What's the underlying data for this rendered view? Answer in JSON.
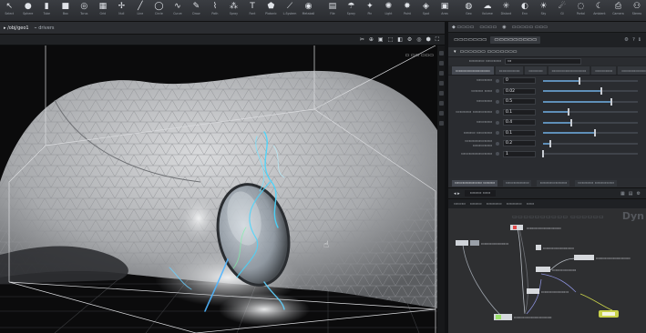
{
  "shelf": {
    "tools": [
      {
        "icon": "cursor-icon",
        "glyph": "↖",
        "label": "Select"
      },
      {
        "icon": "sphere-icon",
        "glyph": "●",
        "label": "Sphere"
      },
      {
        "icon": "tube-icon",
        "glyph": "▮",
        "label": "Tube"
      },
      {
        "icon": "box-icon",
        "glyph": "■",
        "label": "Box"
      },
      {
        "icon": "torus-icon",
        "glyph": "◎",
        "label": "Torus"
      },
      {
        "icon": "grid-icon",
        "glyph": "▦",
        "label": "Grid"
      },
      {
        "icon": "null-icon",
        "glyph": "✢",
        "label": "Null"
      },
      {
        "icon": "line-icon",
        "glyph": "╱",
        "label": "Line"
      },
      {
        "icon": "circle-icon",
        "glyph": "◯",
        "label": "Circle"
      },
      {
        "icon": "curve-icon",
        "glyph": "∿",
        "label": "Curve"
      },
      {
        "icon": "draw-icon",
        "glyph": "✎",
        "label": "Draw"
      },
      {
        "icon": "path-icon",
        "glyph": "⌇",
        "label": "Path"
      },
      {
        "icon": "spray-icon",
        "glyph": "⁂",
        "label": "Spray"
      },
      {
        "icon": "font-icon",
        "glyph": "T",
        "label": "Font"
      },
      {
        "icon": "platonic-icon",
        "glyph": "⬟",
        "label": "Platonic"
      },
      {
        "icon": "lsystem-icon",
        "glyph": "⟋",
        "label": "L-System"
      },
      {
        "icon": "metaball-icon",
        "glyph": "◉",
        "label": "Metaball"
      },
      {
        "icon": "file-icon",
        "glyph": "▤",
        "label": "File"
      },
      {
        "icon": "spray-paint-icon",
        "glyph": "☂",
        "label": "Spray"
      },
      {
        "icon": "pin-icon",
        "glyph": "✦",
        "label": "Pin"
      },
      {
        "icon": "light-icon",
        "glyph": "✺",
        "label": "Light"
      },
      {
        "icon": "point-icon",
        "glyph": "✸",
        "label": "Point"
      },
      {
        "icon": "spot-icon",
        "glyph": "◈",
        "label": "Spot"
      },
      {
        "icon": "area-icon",
        "glyph": "▣",
        "label": "Area"
      },
      {
        "icon": "geo-icon",
        "glyph": "◍",
        "label": "Geo"
      },
      {
        "icon": "volume-icon",
        "glyph": "☁",
        "label": "Volume"
      },
      {
        "icon": "distant-icon",
        "glyph": "✳",
        "label": "Distant"
      },
      {
        "icon": "env-icon",
        "glyph": "◐",
        "label": "Env"
      },
      {
        "icon": "sky-icon",
        "glyph": "☀",
        "label": "Sky"
      },
      {
        "icon": "gi-icon",
        "glyph": "☄",
        "label": "GI"
      },
      {
        "icon": "portal-icon",
        "glyph": "◌",
        "label": "Portal"
      },
      {
        "icon": "ambient-icon",
        "glyph": "☾",
        "label": "Ambient"
      },
      {
        "icon": "camera-icon",
        "glyph": "⎙",
        "label": "Camera"
      },
      {
        "icon": "stereo-icon",
        "glyph": "⚇",
        "label": "Stereo"
      }
    ]
  },
  "viewport": {
    "tabs": [
      "▸ /obj/geo1",
      "⌁ drivers"
    ],
    "toolbar_icons": [
      "✂",
      "⊕",
      "▣",
      "⬚",
      "◧",
      "⚙",
      "◎",
      "⬢",
      "⛶"
    ],
    "view_label": "▭ ▭▭   ▭▭▭"
  },
  "right": {
    "topbar": [
      "◆ ▭▭▭▭",
      "▭▭▭▭",
      "◉",
      "▭▭▭▭▭ ▭▭▭"
    ],
    "param_head": {
      "type": "▭▭▭▭▭▭▭",
      "node": "▭▭▭▭▭▭▭▭▭",
      "icons": [
        "⚙",
        "?",
        "ℹ"
      ]
    },
    "folder": "▭▭▭▭▭▭ ▭▭▭▭▭▭▭",
    "rows": [
      {
        "label": "▭▭▭▭ ▭▭▭▭",
        "value": "▭"
      }
    ],
    "subtabs": [
      "▭▭▭▭▭▭▭▭▭▭",
      "▭▭▭▭▭▭",
      "▭▭▭▭",
      "▭▭▭▭▭▭▭▭▭▭",
      "▭▭▭▭▭",
      "▭▭▭▭▭▭▭"
    ],
    "params": [
      {
        "label": "▭▭▭▭",
        "value": "0",
        "level": 0.38
      },
      {
        "label": "▭▭▭ ▭▭",
        "value": "0.02",
        "level": 0.62
      },
      {
        "label": "▭▭▭▭",
        "value": "0.5",
        "level": 0.72
      },
      {
        "label": "▭▭▭▭ ▭▭▭▭▭",
        "value": "0.1",
        "level": 0.27
      },
      {
        "label": "▭▭▭▭",
        "value": "0.4",
        "level": 0.3
      },
      {
        "label": "▭▭▭ ▭▭▭▭",
        "value": "0.1",
        "level": 0.55
      },
      {
        "label": "▭▭▭▭▭▭▭ ▭▭▭▭▭",
        "value": "0.2",
        "level": 0.08
      },
      {
        "label": "▭▭▭▭▭▭▭▭",
        "value": "1",
        "level": 0.0
      }
    ]
  },
  "network": {
    "tabs": [
      "▭▭▭▭▭▭▭ ▭▭▭",
      "▭▭▭▭▭▭",
      "▭▭▭▭▭▭▭",
      "▭▭▭▭ ▭▭▭▭▭"
    ],
    "crumb": "◂ ▸",
    "path": "▭▭▭ ▭▭",
    "right_icons": [
      "▦",
      "▤",
      "⚙"
    ],
    "toolbar2": [
      "▭▭▭",
      "▭▭▭",
      "▭▭▭▭",
      "▭▭▭▭",
      "▭▭"
    ],
    "title": "▭▭▭▭▭▭▭▭▭▭ ▭▭▭▭▭▭",
    "watermark": "Dyn",
    "nodes": [
      {
        "label": "▭▭▭▭▭▭▭▭",
        "kind": "source"
      },
      {
        "label": "▭▭▭▭▭▭▭▭▭▭",
        "kind": "solver"
      },
      {
        "label": "▭▭▭▭▭▭▭▭▭",
        "kind": "merge"
      },
      {
        "label": "▭▭▭▭▭▭▭",
        "kind": "merge"
      },
      {
        "label": "▭▭▭▭▭▭▭▭▭▭",
        "kind": "null"
      },
      {
        "label": "▭▭▭▭▭▭▭▭",
        "kind": "output"
      },
      {
        "label": "▭▭▭▭▭▭▭▭▭▭▭",
        "kind": "display"
      }
    ]
  },
  "colors": {
    "accent": "#5f8fb8",
    "display_flag": "#c9d24a",
    "render_flag": "#9be26b",
    "fx_cyan": "#45d6ff",
    "wire": "#8a8fd8"
  }
}
